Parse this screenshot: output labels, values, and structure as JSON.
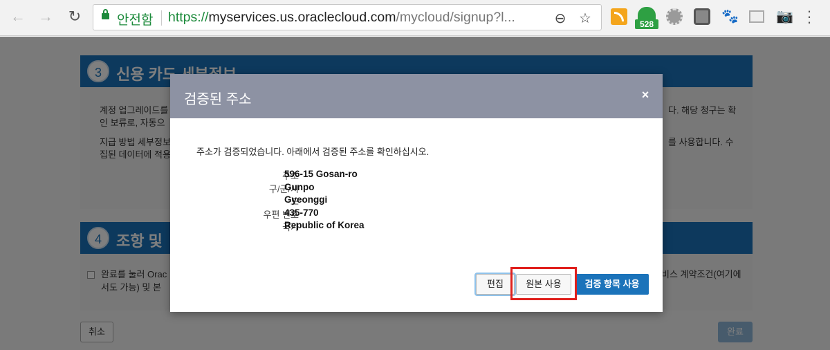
{
  "browser": {
    "secure_label": "안전함",
    "url_scheme": "https://",
    "url_host": "myservices.us.oraclecloud.com",
    "url_path": "/mycloud/signup?l...",
    "extension_badge": "528",
    "icons": [
      "back-arrow-icon",
      "forward-arrow-icon",
      "reload-icon",
      "lock-icon",
      "zoom-icon",
      "star-icon",
      "rss-icon",
      "gear-icon",
      "paw-icon",
      "camera-icon",
      "menu-dots-icon"
    ]
  },
  "page": {
    "section3": {
      "number": "3",
      "title": "신용 카드 세부정보",
      "text_line1_left": "계정 업그레이드를",
      "text_line1_right": "다. 해당 청구는 확",
      "text_line2_left": "인 보류로, 자동으",
      "text_line3_left": "지급 방법 세부정보",
      "text_line3_right": "를 사용합니다. 수",
      "text_line4_left": "집된 데이터에 적용"
    },
    "section4": {
      "number": "4",
      "title": "조항 및",
      "text_line1_left": "완료를 눌러 Orac",
      "text_line1_right": "비스 계약조건(여기에",
      "text_line2_left": "서도 가능) 및 본"
    },
    "cancel_label": "취소",
    "done_label": "완료"
  },
  "modal": {
    "title": "검증된 주소",
    "close": "×",
    "message": "주소가 검증되었습니다. 아래에서 검증된 주소를 확인하십시오.",
    "address": [
      {
        "label": "주소",
        "value": "596-15 Gosan-ro"
      },
      {
        "label": "구/군/시",
        "value": "Gunpo"
      },
      {
        "label": "도",
        "value": "Gyeonggi"
      },
      {
        "label": "우편 번호",
        "value": "435-770"
      },
      {
        "label": "국가",
        "value": "Republic of Korea"
      }
    ],
    "buttons": {
      "edit": "편집",
      "use_original": "원본 사용",
      "use_verified": "검증 항목 사용"
    }
  },
  "colors": {
    "brand_blue": "#1b73ba",
    "modal_header": "#8d92a3",
    "secure_green": "#1b8a3a",
    "highlight_red": "#e0201d"
  }
}
